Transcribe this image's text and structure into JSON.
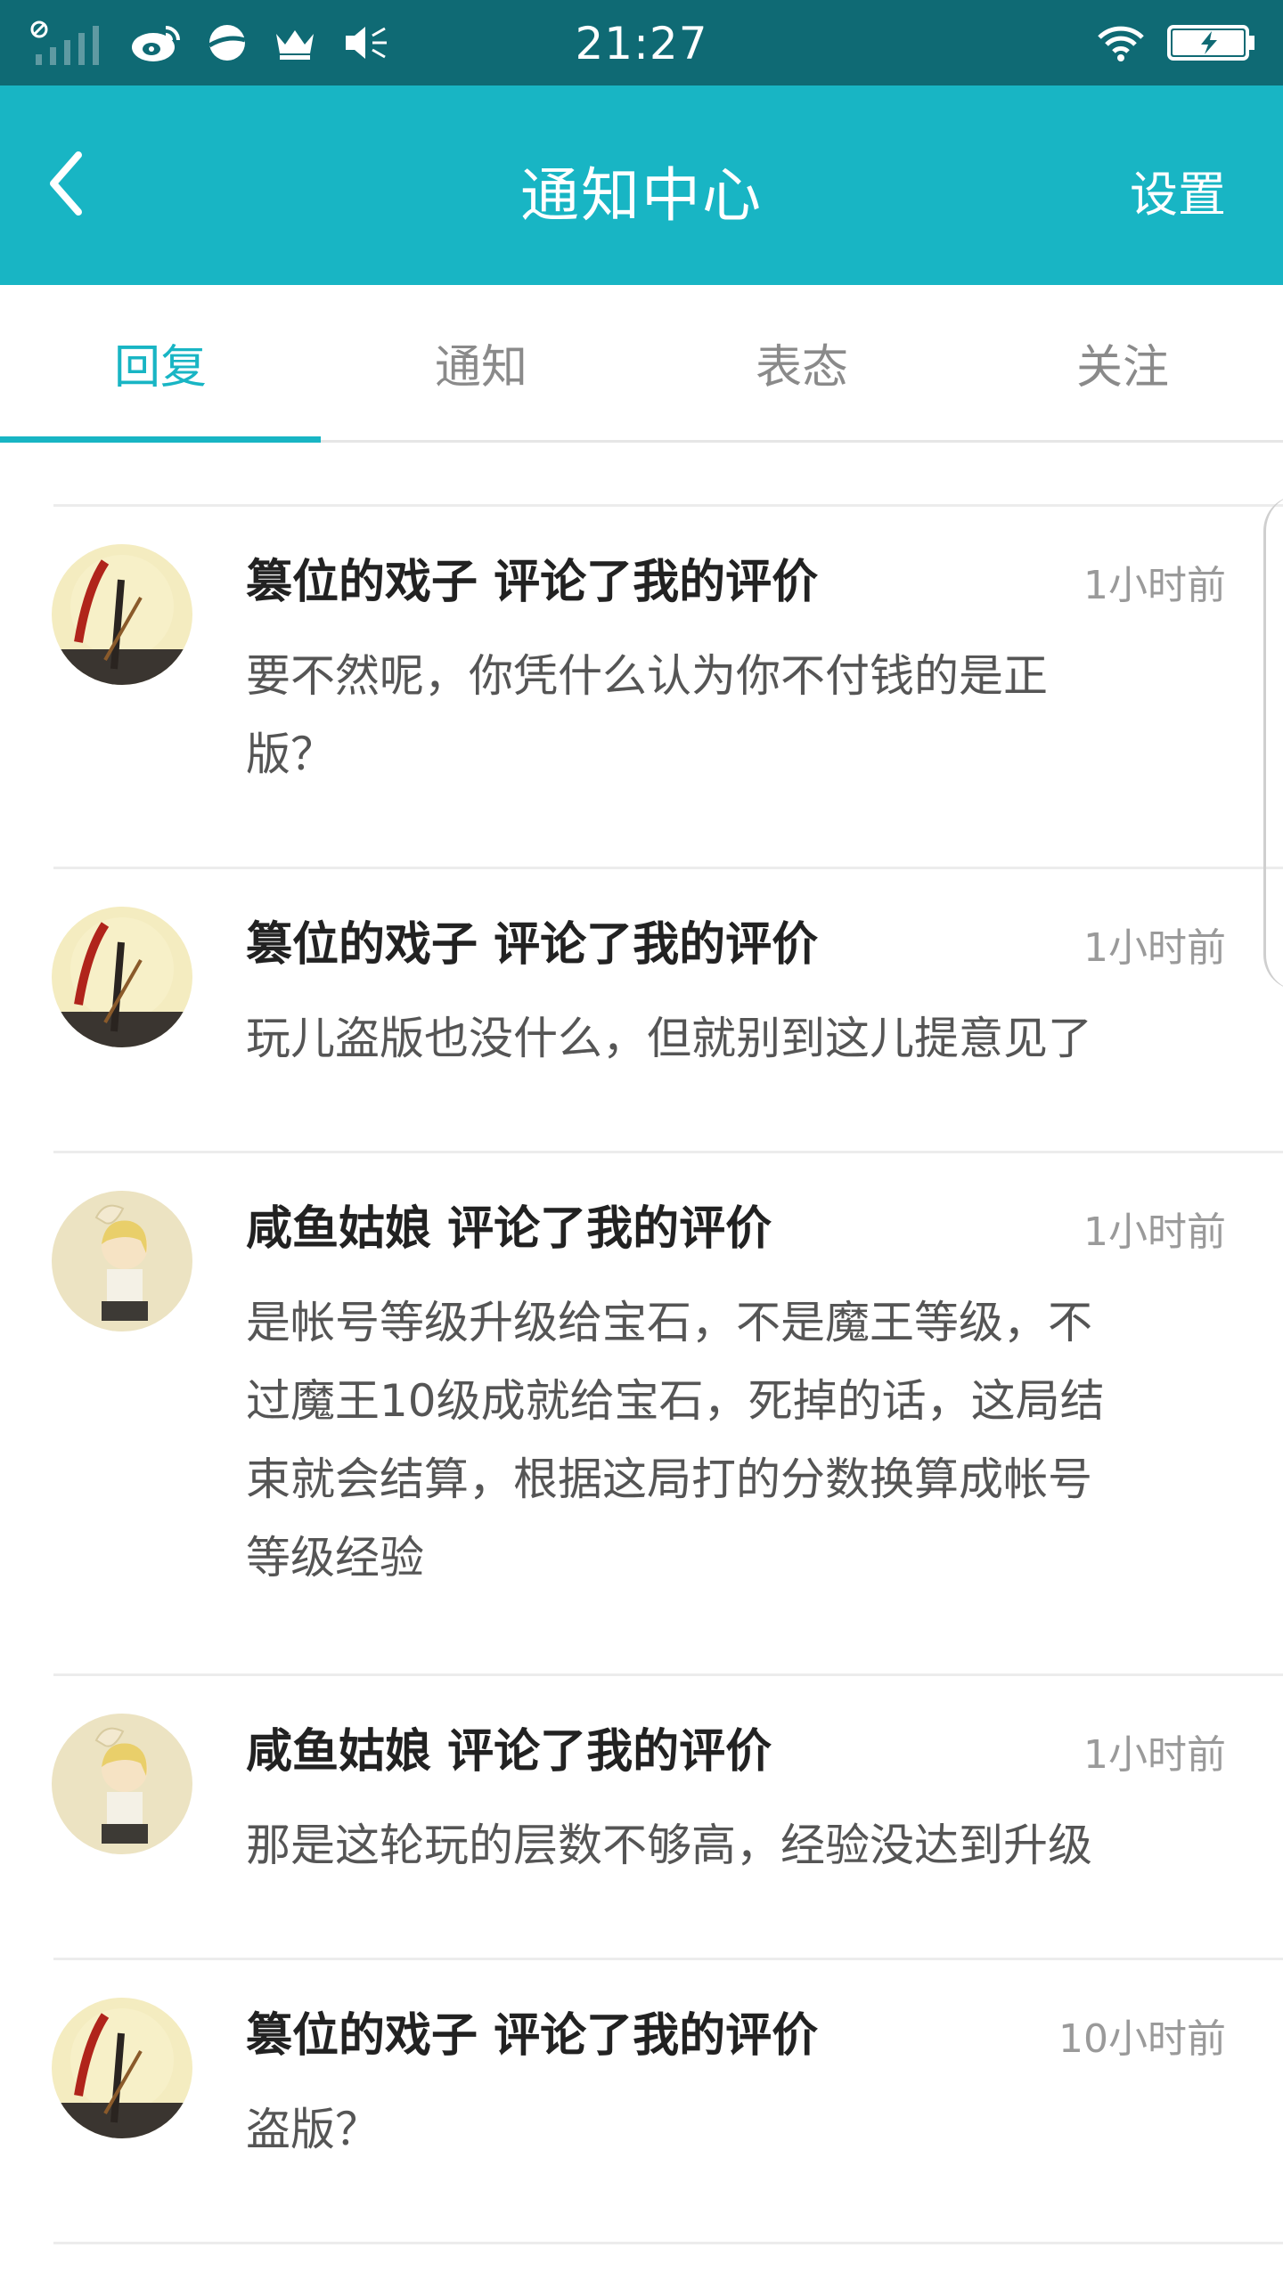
{
  "status_bar": {
    "time": "21:27",
    "left_icons": [
      "no-sim-signal-icon",
      "weibo-icon",
      "planet-icon",
      "crown-icon",
      "volume-icon"
    ],
    "right_icons": [
      "wifi-icon",
      "battery-charging-icon"
    ]
  },
  "header": {
    "title": "通知中心",
    "settings_label": "设置",
    "background_color": "#18b5c4"
  },
  "tabs": [
    {
      "label": "回复",
      "active": true
    },
    {
      "label": "通知",
      "active": false
    },
    {
      "label": "表态",
      "active": false
    },
    {
      "label": "关注",
      "active": false
    }
  ],
  "accent_color": "#18b5c4",
  "notifications": [
    {
      "user": "篡位的戏子",
      "title": "篡位的戏子 评论了我的评价",
      "time": "1小时前",
      "lines": [
        "要不然呢，你凭什么认为你不付钱的是正",
        "版？"
      ],
      "avatar": "avatar-monkey-king"
    },
    {
      "user": "篡位的戏子",
      "title": "篡位的戏子 评论了我的评价",
      "time": "1小时前",
      "lines": [
        "玩儿盗版也没什么，但就别到这儿提意见了"
      ],
      "avatar": "avatar-monkey-king"
    },
    {
      "user": "咸鱼姑娘",
      "title": "咸鱼姑娘 评论了我的评价",
      "time": "1小时前",
      "lines": [
        "是帐号等级升级给宝石，不是魔王等级，不",
        "过魔王10级成就给宝石，死掉的话，这局结",
        "束就会结算，根据这局打的分数换算成帐号",
        "等级经验"
      ],
      "avatar": "avatar-anime-girl"
    },
    {
      "user": "咸鱼姑娘",
      "title": "咸鱼姑娘 评论了我的评价",
      "time": "1小时前",
      "lines": [
        "那是这轮玩的层数不够高，经验没达到升级"
      ],
      "avatar": "avatar-anime-girl"
    },
    {
      "user": "篡位的戏子",
      "title": "篡位的戏子 评论了我的评价",
      "time": "10小时前",
      "lines": [
        "盗版？"
      ],
      "avatar": "avatar-monkey-king"
    }
  ]
}
